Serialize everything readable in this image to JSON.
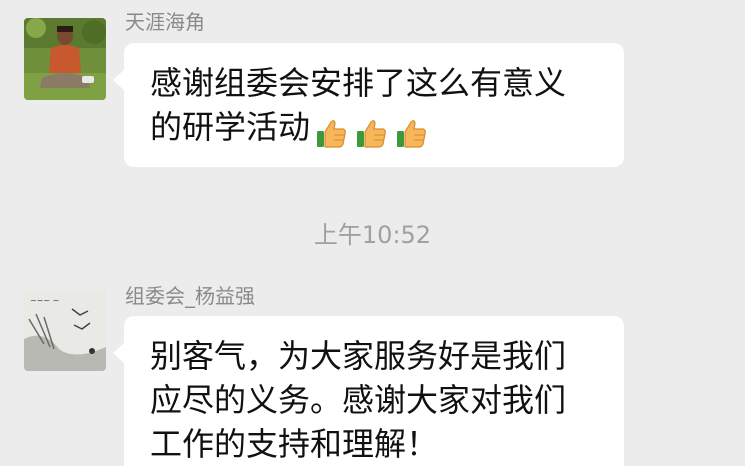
{
  "messages": [
    {
      "sender": "天涯海角",
      "lines": [
        "感谢组委会安排了这么有意义",
        "的研学活动"
      ],
      "emoji": [
        "thumbs-up-icon",
        "thumbs-up-icon",
        "thumbs-up-icon"
      ]
    },
    {
      "sender": "组委会_杨益强",
      "lines": [
        "别客气，为大家服务好是我们",
        "应尽的义务。感谢大家对我们",
        "工作的支持和理解！"
      ]
    }
  ],
  "timestamp": "上午10:52",
  "colors": {
    "background": "#ececec",
    "bubble": "#ffffff",
    "sender_text": "#8a8a8a",
    "timestamp_text": "#a0a0a0"
  }
}
